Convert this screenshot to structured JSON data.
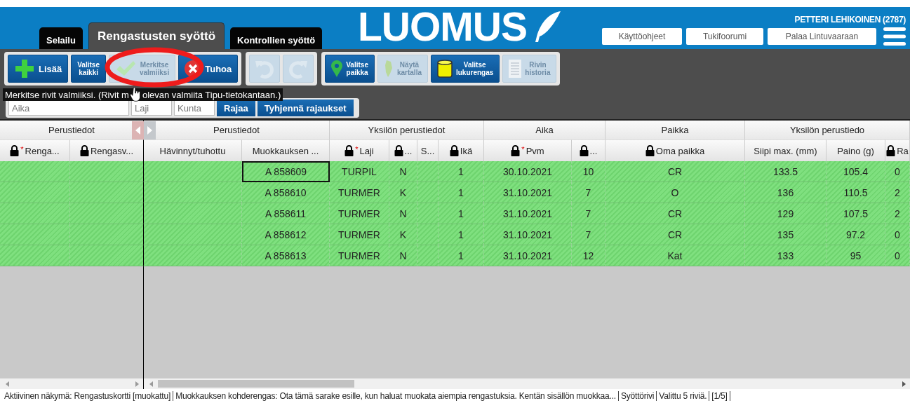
{
  "header": {
    "tabs": [
      {
        "label": "Selailu",
        "selected": false
      },
      {
        "label": "Rengastusten syöttö",
        "selected": true
      },
      {
        "label": "Kontrollien syöttö",
        "selected": false
      }
    ],
    "logo": "LUOMUS",
    "user": "PETTERI LEHIKOINEN (2787)",
    "links": [
      "Käyttöohjeet",
      "Tukifoorumi",
      "Palaa Lintuvaaraan"
    ]
  },
  "toolbar": {
    "groups": [
      [
        {
          "label": "Lisää",
          "kind": "add",
          "disabled": false
        },
        {
          "label": "Valitse\nkaikki",
          "kind": "select",
          "disabled": false
        },
        {
          "label": "Merkitse\nvalmiiksi",
          "kind": "complete",
          "disabled": true
        },
        {
          "label": "Tuhoa",
          "kind": "delete",
          "disabled": false
        }
      ],
      [
        {
          "kind": "undo",
          "disabled": true
        },
        {
          "kind": "redo",
          "disabled": true
        }
      ],
      [
        {
          "label": "Valitse\npaikka",
          "kind": "place",
          "disabled": false
        },
        {
          "label": "Näytä\nkartalla",
          "kind": "map",
          "disabled": true
        },
        {
          "label": "Valitse\nlukurengas",
          "kind": "ring",
          "disabled": false
        },
        {
          "label": "Rivin\nhistoria",
          "kind": "history",
          "disabled": true
        }
      ]
    ],
    "filters": [
      {
        "placeholder": "Aika"
      },
      {
        "placeholder": "Laji"
      },
      {
        "placeholder": "Kunta"
      }
    ],
    "filter_buttons": [
      "Rajaa",
      "Tyhjennä rajaukset"
    ],
    "tooltip": [
      "Merkitse rivit valmiiksi. (Rivit m",
      "olevan valmiita Tipu-tietokantaan.)"
    ]
  },
  "table": {
    "groups": [
      {
        "title": "Perustiedot",
        "frozen": true,
        "columns": [
          {
            "label": "Renga...",
            "locked": true,
            "mark": "*"
          },
          {
            "label": "Rengasv...",
            "locked": true
          }
        ]
      },
      {
        "title": "Perustiedot",
        "frozen": false,
        "columns": [
          {
            "label": "Hävinnyt/tuhottu",
            "locked": false
          },
          {
            "label": "Muokkauksen ...",
            "locked": false,
            "current": true
          }
        ]
      },
      {
        "title": "Yksilön perustiedot",
        "frozen": false,
        "columns": [
          {
            "label": "Laji",
            "locked": true,
            "mark": "*"
          },
          {
            "label": "...",
            "locked": true
          },
          {
            "label": "S...",
            "locked": false
          },
          {
            "label": "Ikä",
            "locked": true
          }
        ]
      },
      {
        "title": "Aika",
        "frozen": false,
        "columns": [
          {
            "label": "Pvm",
            "locked": true,
            "mark": "*"
          },
          {
            "label": "...",
            "locked": true
          }
        ]
      },
      {
        "title": "Paikka",
        "frozen": false,
        "columns": [
          {
            "label": "Oma paikka",
            "locked": true
          }
        ]
      },
      {
        "title": "Yksilön perustiedo",
        "frozen": false,
        "columns": [
          {
            "label": "Siipi max. (mm)",
            "locked": false
          },
          {
            "label": "Paino (g)",
            "locked": false
          },
          {
            "label": "Ra",
            "locked": true
          }
        ]
      }
    ],
    "rows": [
      {
        "focused": true,
        "cells": [
          null,
          null,
          null,
          "A 858609",
          "TURPIL",
          "N",
          null,
          "1",
          "30.10.2021",
          "10",
          "CR",
          "133.5",
          "105.4",
          "0"
        ]
      },
      {
        "focused": false,
        "cells": [
          null,
          null,
          null,
          "A 858610",
          "TURMER",
          "K",
          null,
          "1",
          "31.10.2021",
          "7",
          "O",
          "136",
          "110.5",
          "2"
        ]
      },
      {
        "focused": false,
        "cells": [
          null,
          null,
          null,
          "A 858611",
          "TURMER",
          "N",
          null,
          "1",
          "31.10.2021",
          "7",
          "CR",
          "129",
          "107.5",
          "2"
        ]
      },
      {
        "focused": false,
        "cells": [
          null,
          null,
          null,
          "A 858612",
          "TURMER",
          "K",
          null,
          "1",
          "31.10.2021",
          "7",
          "CR",
          "135",
          "97.2",
          "0"
        ]
      },
      {
        "focused": false,
        "cells": [
          null,
          null,
          null,
          "A 858613",
          "TURMER",
          "N",
          null,
          "1",
          "31.10.2021",
          "12",
          "Kat",
          "133",
          "95",
          "0"
        ]
      }
    ]
  },
  "status_bar": [
    "Aktiivinen näkymä: Rengastuskortti [muokattu]",
    "Muokkauksen kohderengas: Ota tämä sarake esille, kun haluat muokata aiempia rengastuksia. Kentän sisällön muokkaa...",
    "Syöttörivi",
    "Valittu 5 riviä.",
    "[1/5]"
  ]
}
